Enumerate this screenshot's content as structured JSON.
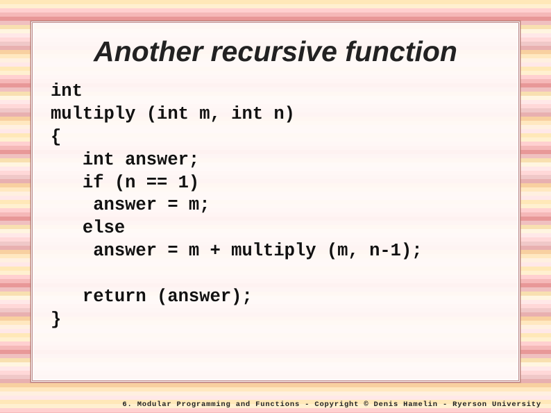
{
  "slide": {
    "title": "Another recursive function",
    "code": "int\nmultiply (int m, int n)\n{\n   int answer;\n   if (n == 1)\n    answer = m;\n   else\n    answer = m + multiply (m, n-1);\n\n   return (answer);\n}",
    "footer": "6. Modular Programming and Functions - Copyright © Denis Hamelin - Ryerson University"
  }
}
